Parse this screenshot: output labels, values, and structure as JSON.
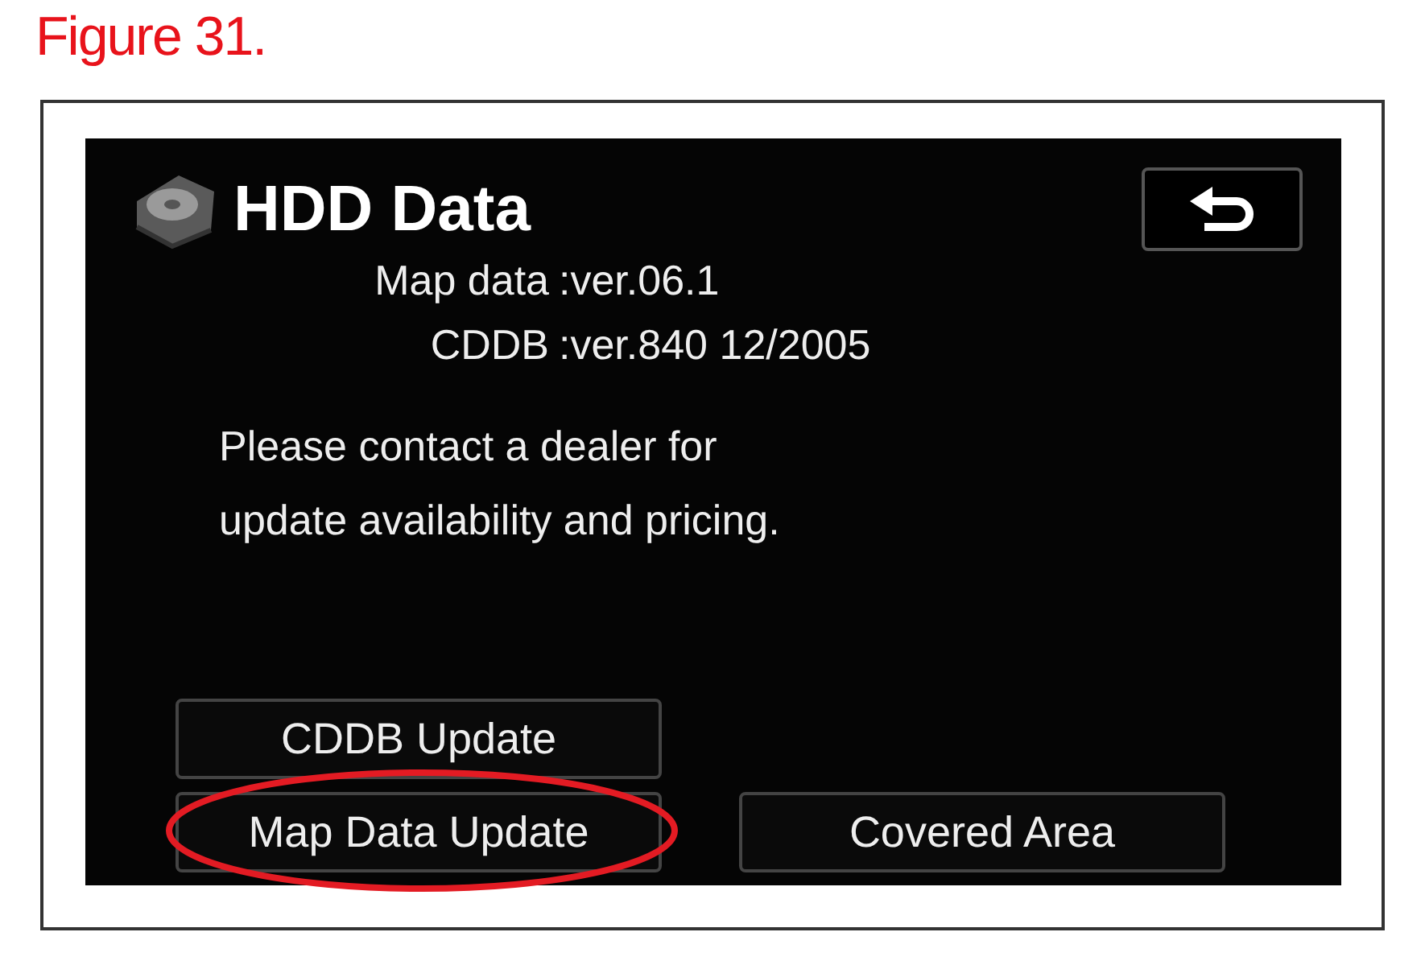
{
  "figure_caption": "Figure 31.",
  "screen": {
    "title": "HDD Data",
    "info": [
      {
        "label": "Map data",
        "value": ":ver.06.1"
      },
      {
        "label": "CDDB",
        "value": ":ver.840 12/2005"
      }
    ],
    "message_lines": [
      "Please contact a dealer for",
      "update availability and pricing."
    ],
    "left_buttons": [
      {
        "label": "CDDB Update",
        "highlighted": false
      },
      {
        "label": "Map Data Update",
        "highlighted": true
      }
    ],
    "right_buttons": [
      {
        "label": "Covered Area",
        "highlighted": false
      }
    ]
  }
}
